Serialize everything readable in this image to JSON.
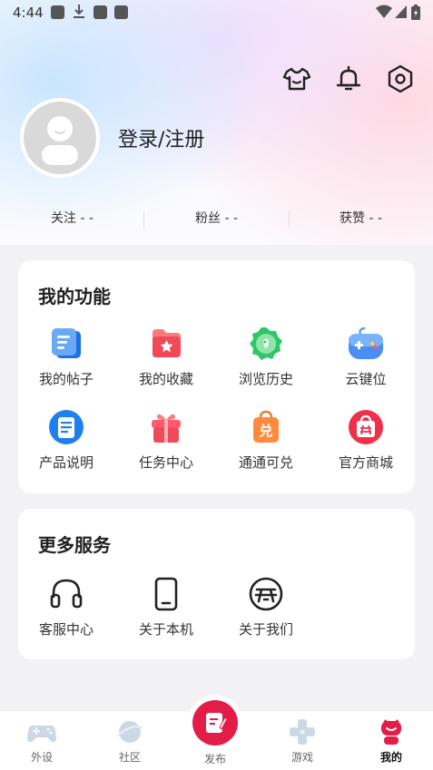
{
  "status_bar": {
    "time": "4:44"
  },
  "header": {
    "login_text": "登录/注册",
    "stats": [
      {
        "label": "关注",
        "value": "- -"
      },
      {
        "label": "粉丝",
        "value": "- -"
      },
      {
        "label": "获赞",
        "value": "- -"
      }
    ]
  },
  "functions": {
    "title": "我的功能",
    "items": [
      {
        "label": "我的帖子",
        "icon": "posts-icon"
      },
      {
        "label": "我的收藏",
        "icon": "favorites-icon"
      },
      {
        "label": "浏览历史",
        "icon": "history-icon"
      },
      {
        "label": "云键位",
        "icon": "cloud-keymap-icon"
      },
      {
        "label": "产品说明",
        "icon": "manual-icon"
      },
      {
        "label": "任务中心",
        "icon": "task-gift-icon"
      },
      {
        "label": "通通可兑",
        "icon": "redeem-icon"
      },
      {
        "label": "官方商城",
        "icon": "store-icon"
      }
    ]
  },
  "services": {
    "title": "更多服务",
    "items": [
      {
        "label": "客服中心",
        "icon": "headset-icon"
      },
      {
        "label": "关于本机",
        "icon": "phone-icon"
      },
      {
        "label": "关于我们",
        "icon": "brand-logo-icon"
      }
    ]
  },
  "tabbar": {
    "tabs": [
      {
        "label": "外设",
        "icon": "gamepad-icon"
      },
      {
        "label": "社区",
        "icon": "planet-icon"
      },
      {
        "label": "发布",
        "icon": "publish-icon"
      },
      {
        "label": "游戏",
        "icon": "dpad-icon"
      },
      {
        "label": "我的",
        "icon": "profile-icon"
      }
    ],
    "active": "我的"
  },
  "colors": {
    "accent": "#e11d48",
    "card": "#ffffff",
    "background": "#f2f2f4"
  }
}
